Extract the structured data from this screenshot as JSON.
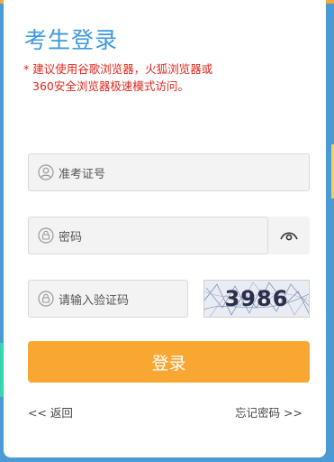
{
  "form": {
    "title": "考生登录",
    "notice_line1": "* 建议使用谷歌浏览器，火狐浏览器或",
    "notice_line2": "360安全浏览器极速模式访问。",
    "id_placeholder": "准考证号",
    "password_placeholder": "密码",
    "captcha_placeholder": "请输入验证码",
    "captcha_code": "3986",
    "login_label": "登录",
    "back_link": "<< 返回",
    "forgot_link": "忘记密码 >>"
  },
  "icons": {
    "id": "user-icon",
    "password": "lock-icon",
    "captcha": "lock-icon",
    "visibility": "eye-icon"
  },
  "colors": {
    "title": "#3d99de",
    "notice": "#e2261a",
    "button": "#f8a733",
    "background": "#4a9ad6"
  }
}
